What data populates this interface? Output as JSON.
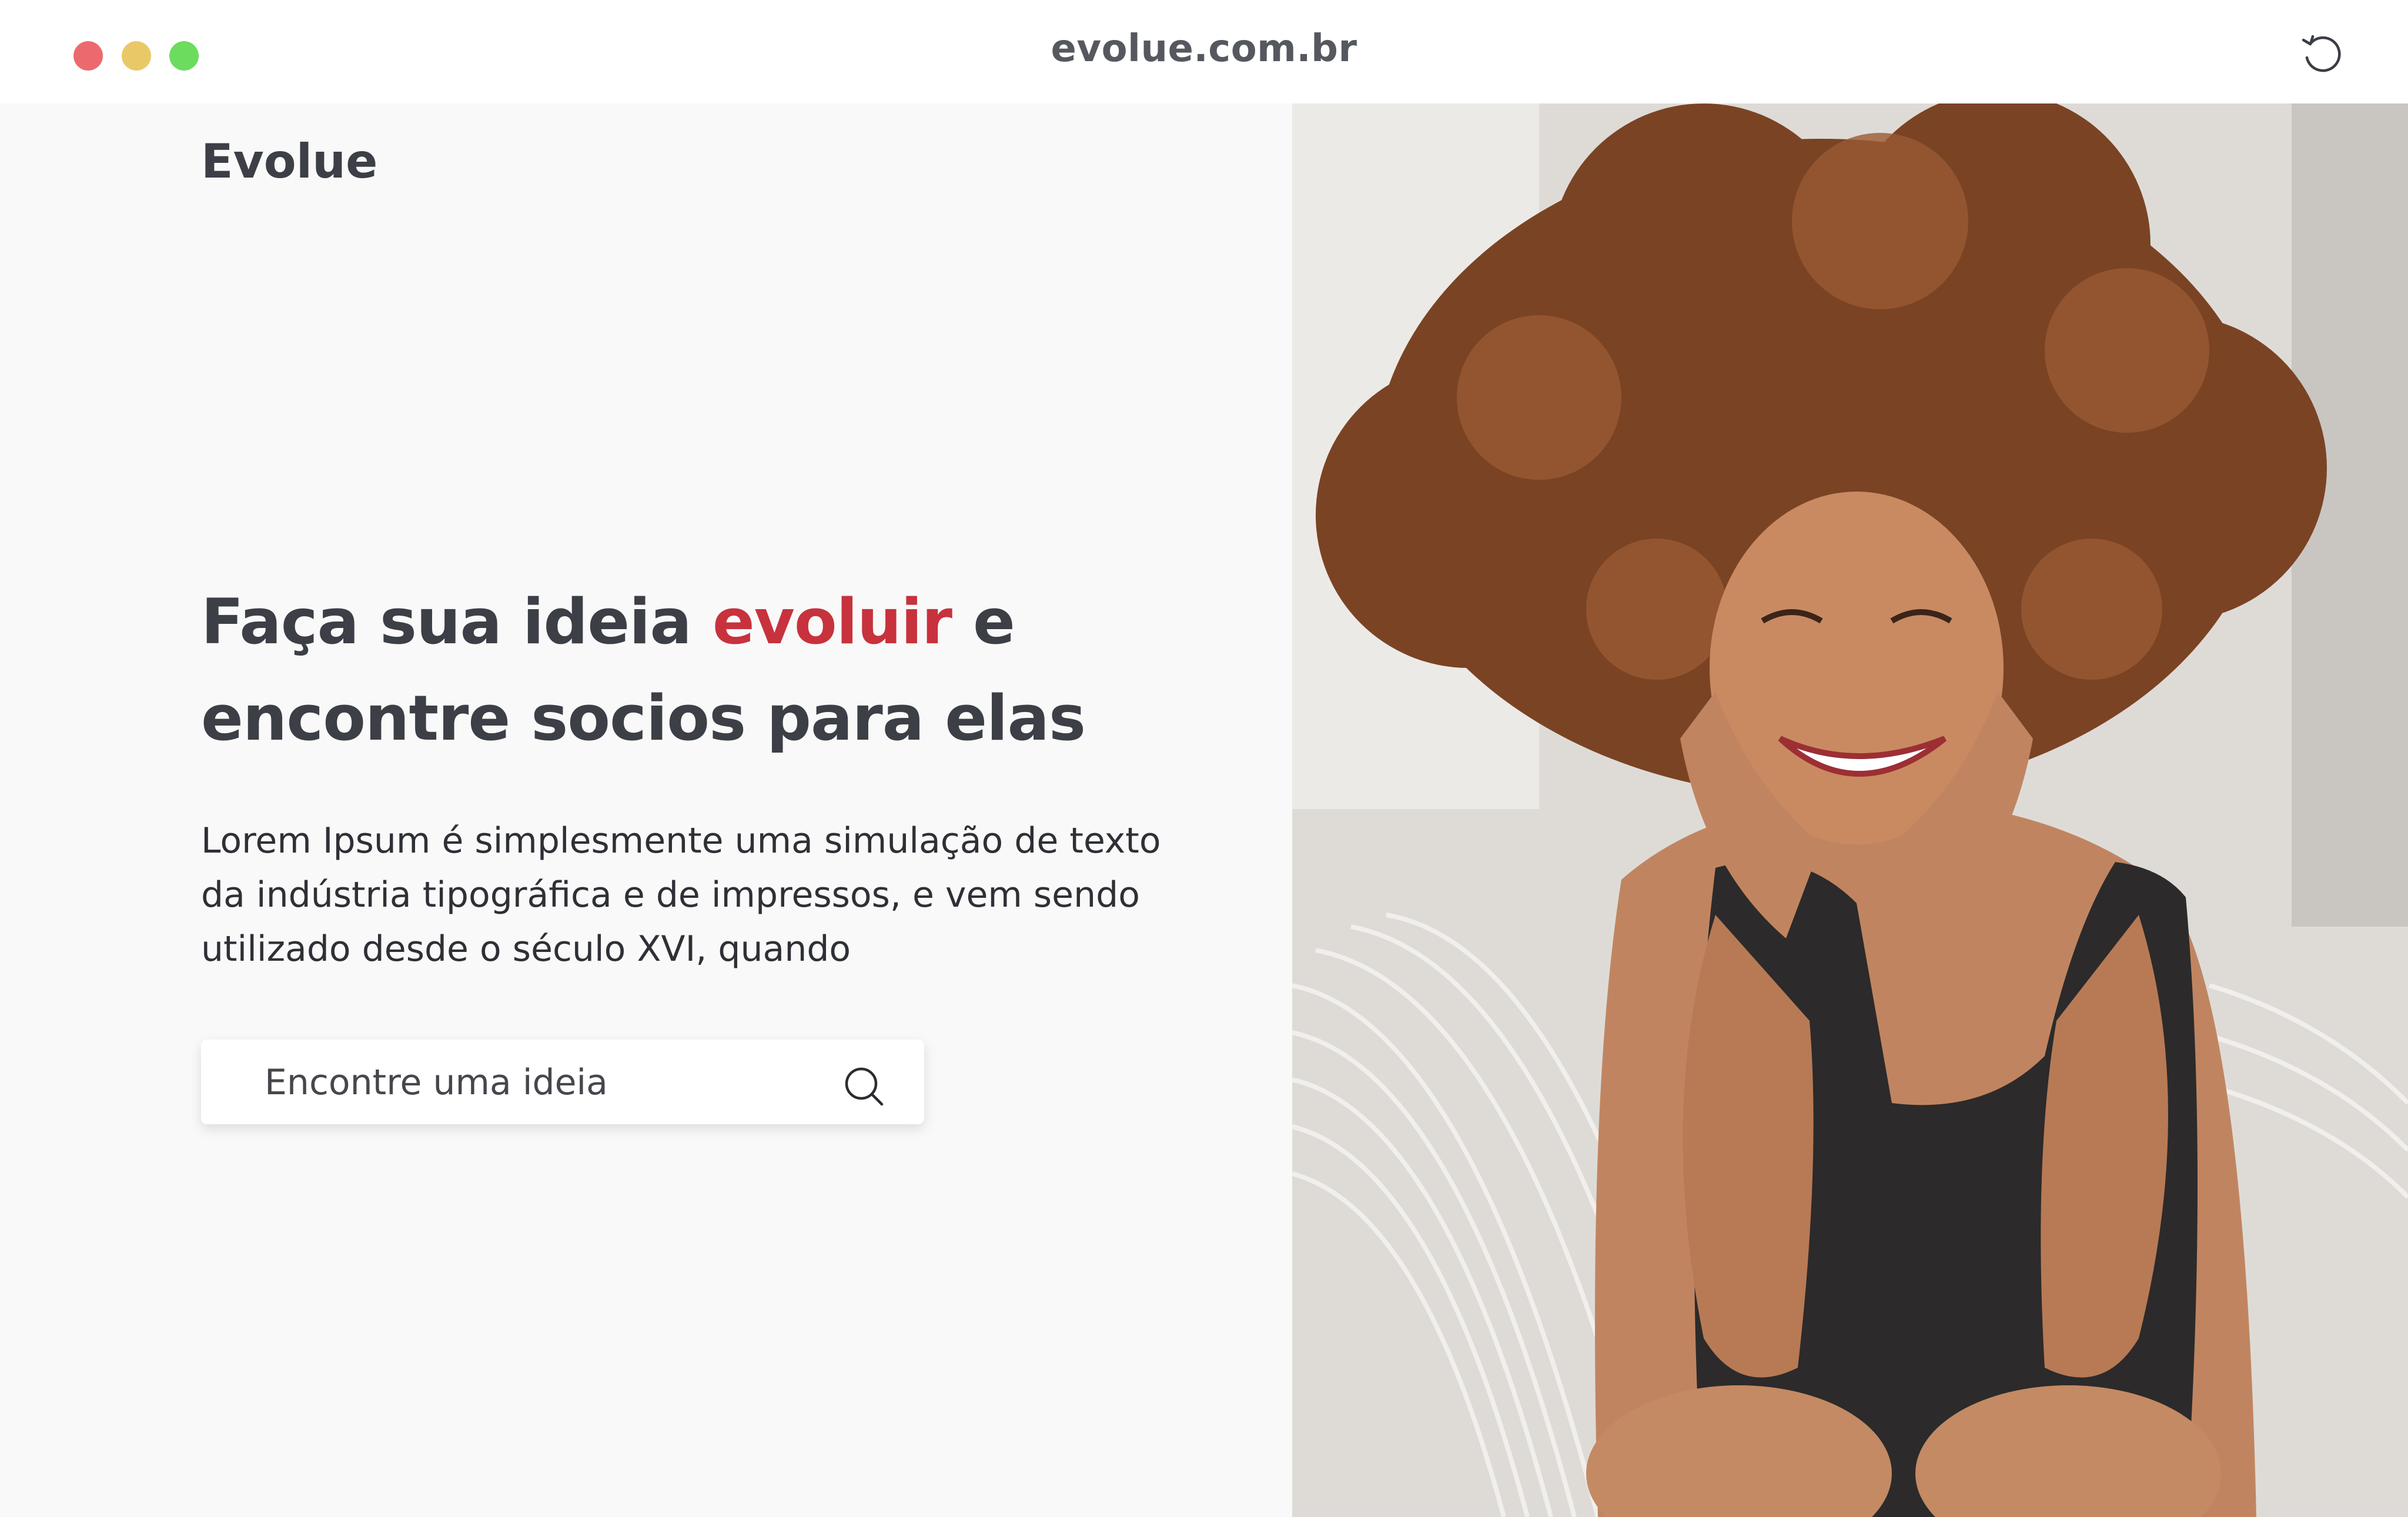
{
  "browser": {
    "url": "evolue.com.br",
    "window_controls": [
      "close",
      "minimize",
      "maximize"
    ],
    "reload_icon": "reload-icon"
  },
  "brand": {
    "name": "Evolue"
  },
  "hero": {
    "headline_part1": "Faça sua ideia ",
    "headline_accent": "evoluir",
    "headline_part2": " e",
    "headline_line2": "encontre socios para elas",
    "description": "Lorem Ipsum é simplesmente uma simulação de texto da indústria tipográfica e de impressos, e vem sendo utilizado desde o século XVI, quando"
  },
  "search": {
    "placeholder": "Encontre uma ideia",
    "icon": "search-icon"
  },
  "image": {
    "subject": "smiling woman with curly hair resting face in hands"
  },
  "colors": {
    "accent": "#c7323d",
    "text": "#3c3f46",
    "background_left": "#f9f9f9",
    "dot_red": "#ec6a6e",
    "dot_yellow": "#e9c867",
    "dot_green": "#6cdc5f"
  }
}
